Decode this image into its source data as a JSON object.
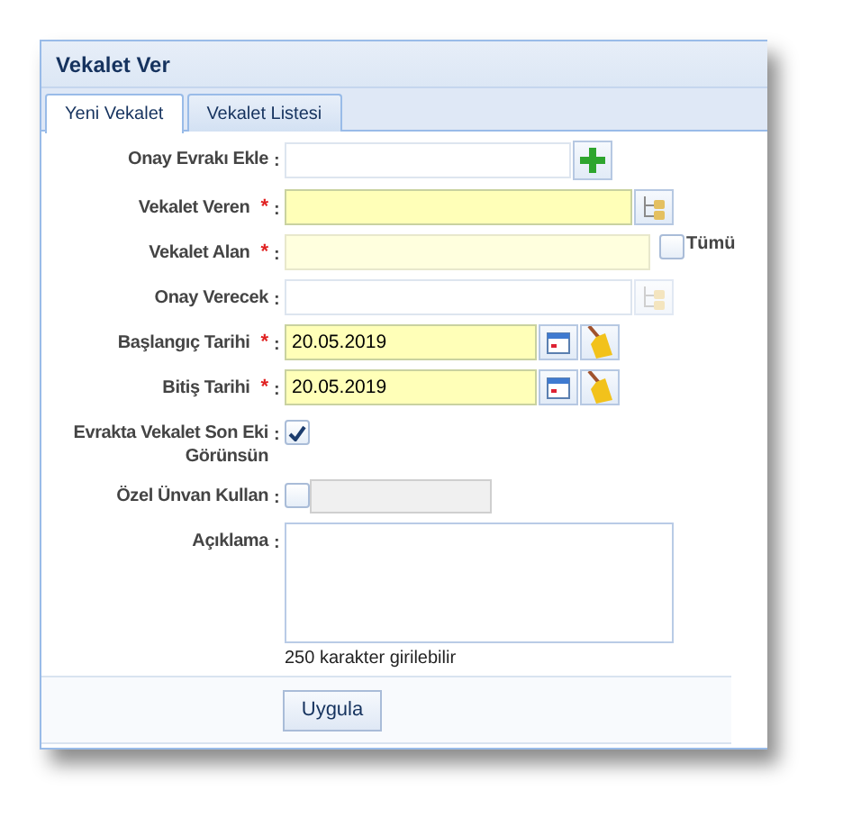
{
  "window": {
    "title": "Vekalet Ver"
  },
  "tabs": [
    {
      "label": "Yeni Vekalet",
      "selected": true
    },
    {
      "label": "Vekalet Listesi",
      "selected": false
    }
  ],
  "fields": [
    {
      "kind": "upload",
      "label": "Onay Evrakı Ekle",
      "colon": ":"
    },
    {
      "kind": "lookup",
      "label": "Vekalet Veren",
      "required_mark": "*",
      "colon": ":",
      "disabled": false
    },
    {
      "kind": "lookup_all",
      "label": "Vekalet Alan",
      "required_mark": "*",
      "colon": ":",
      "all_label": "Tümü",
      "all_checked": false
    },
    {
      "kind": "lookup",
      "label": "Onay Verecek",
      "colon": ":",
      "disabled": true
    },
    {
      "kind": "date",
      "label": "Başlangıç Tarihi",
      "required_mark": "*",
      "colon": ":",
      "value": "20.05.2019"
    },
    {
      "kind": "date",
      "label": "Bitiş Tarihi",
      "required_mark": "*",
      "colon": ":",
      "value": "20.05.2019"
    },
    {
      "kind": "checkbox",
      "label": "Evrakta Vekalet Son Eki Görünsün",
      "colon": ":",
      "checked": true
    },
    {
      "kind": "checkbox_text",
      "label": "Özel Ünvan Kullan",
      "colon": ":",
      "checked": false,
      "disabled": true
    },
    {
      "kind": "textarea",
      "label": "Açıklama",
      "colon": ":",
      "hint": "250 karakter girilebilir"
    }
  ],
  "buttons": [
    {
      "label": "Uygula"
    }
  ]
}
